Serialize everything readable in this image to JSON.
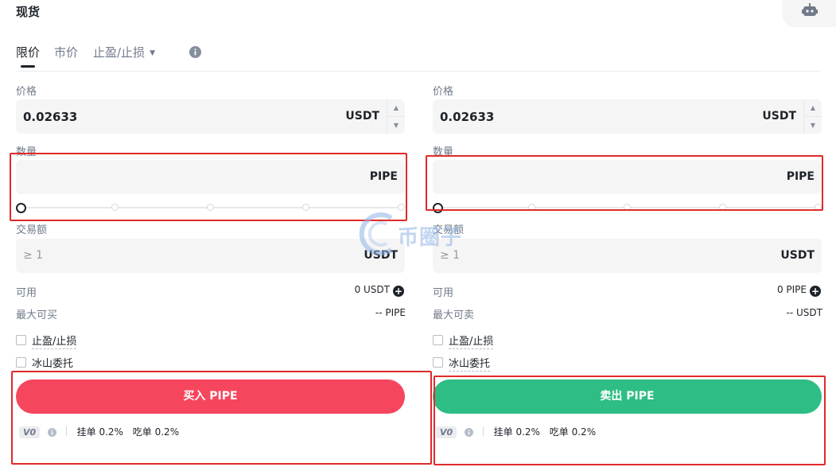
{
  "title": "现货",
  "tabs": {
    "limit": "限价",
    "market": "市价",
    "tpsl": "止盈/止损"
  },
  "buy": {
    "price_label": "价格",
    "price_value": "0.02633",
    "price_unit": "USDT",
    "amount_label": "数量",
    "amount_unit": "PIPE",
    "total_label": "交易额",
    "total_placeholder": "≥ 1",
    "total_unit": "USDT",
    "avail_label": "可用",
    "avail_value": "0 USDT",
    "max_label": "最大可买",
    "max_value": "-- PIPE",
    "tpsl_label": "止盈/止损",
    "iceberg_label": "冰山委托",
    "button_label": "买入 PIPE"
  },
  "sell": {
    "price_label": "价格",
    "price_value": "0.02633",
    "price_unit": "USDT",
    "amount_label": "数量",
    "amount_unit": "PIPE",
    "total_label": "交易额",
    "total_placeholder": "≥ 1",
    "total_unit": "USDT",
    "avail_label": "可用",
    "avail_value": "0 PIPE",
    "max_label": "最大可卖",
    "max_value": "-- USDT",
    "tpsl_label": "止盈/止损",
    "iceberg_label": "冰山委托",
    "button_label": "卖出 PIPE"
  },
  "fees": {
    "vip": "V0",
    "maker": "挂单 0.2%",
    "taker": "吃单 0.2%"
  },
  "watermark": "币圈子",
  "colors": {
    "buy": "#f6465d",
    "sell": "#2ebd85",
    "highlight_box": "#e02a2a"
  },
  "icons": [
    "robot-icon",
    "info-icon",
    "chevron-down-icon",
    "plus-circle-icon",
    "checkbox-icon"
  ]
}
